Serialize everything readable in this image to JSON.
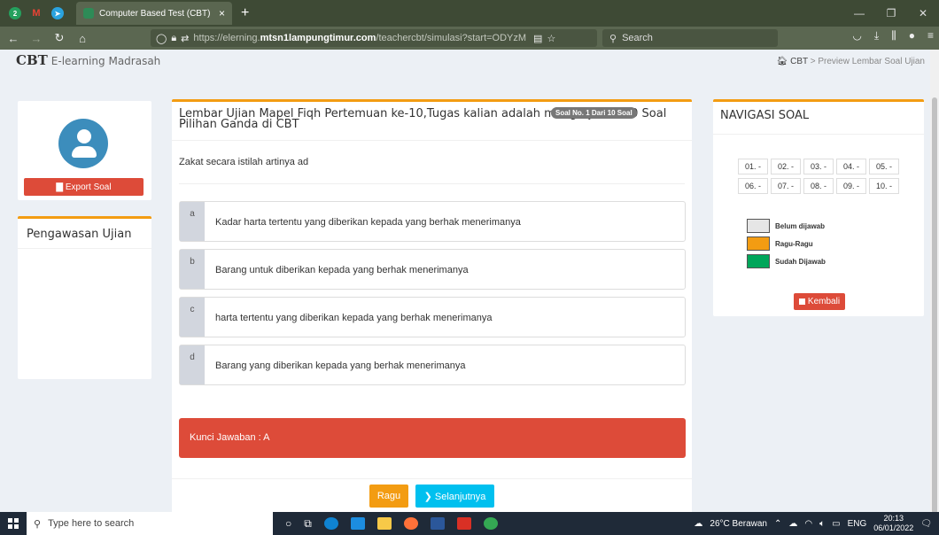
{
  "browser": {
    "tab_title": "Computer Based Test (CBT)",
    "tab_close": "×",
    "new_tab": "+",
    "url_prefix": "https://elerning.",
    "url_host": "mtsn1lampungtimur.com",
    "url_path": "/teachercbt/simulasi?start=ODYzM",
    "search_placeholder": "Search"
  },
  "page": {
    "brand": "CBT",
    "brand_sub": "E-learning Madrasah",
    "breadcrumb_home": "CBT",
    "breadcrumb_current": "Preview Lembar Soal Ujian"
  },
  "sidebar": {
    "export_label": "Export Soal",
    "pengawasan_title": "Pengawasan Ujian"
  },
  "exam": {
    "title": "Lembar Ujian Mapel Fiqh Pertemuan ke-10,Tugas kalian adalah mengerjakan 10 Soal Pilihan Ganda di CBT",
    "badge": "Soal No. 1 Dari 10 Soal",
    "question": "Zakat secara istilah artinya ad",
    "options": [
      {
        "letter": "a",
        "text": "Kadar harta tertentu yang diberikan kepada yang berhak menerimanya"
      },
      {
        "letter": "b",
        "text": "Barang  untuk diberikan kepada yang berhak menerimanya"
      },
      {
        "letter": "c",
        "text": " harta tertentu yang diberikan kepada yang berhak menerimanya"
      },
      {
        "letter": "d",
        "text": "Barang yang diberikan kepada yang berhak menerimanya"
      }
    ],
    "kunci": "Kunci Jawaban : A",
    "ragu_label": "Ragu",
    "next_label": "Selanjutnya"
  },
  "nav": {
    "title": "NAVIGASI SOAL",
    "cells": [
      "01. -",
      "02. -",
      "03. -",
      "04. -",
      "05. -",
      "06. -",
      "07. -",
      "08. -",
      "09. -",
      "10. -"
    ],
    "legend": [
      {
        "label": "Belum dijawab",
        "color": "#e6e6e6"
      },
      {
        "label": "Ragu-Ragu",
        "color": "#f39c12"
      },
      {
        "label": "Sudah Dijawab",
        "color": "#00a65a"
      }
    ],
    "kembali_label": "Kembali"
  },
  "taskbar": {
    "search_placeholder": "Type here to search",
    "weather": "26°C Berawan",
    "lang": "ENG",
    "time": "20:13",
    "date": "06/01/2022"
  }
}
